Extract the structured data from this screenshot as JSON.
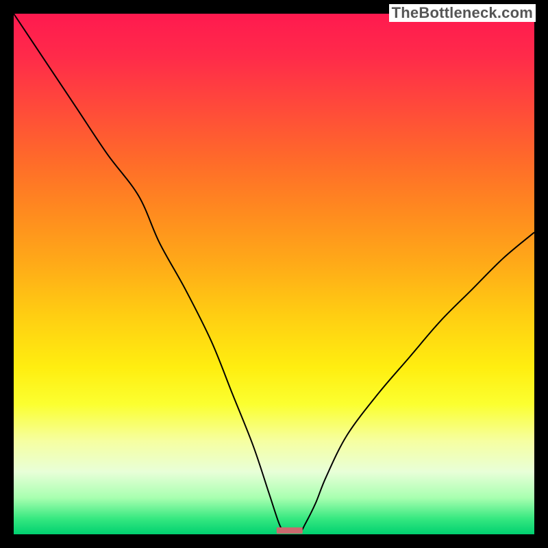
{
  "watermark": "TheBottleneck.com",
  "marker": {
    "x": 53,
    "width": 5,
    "height": 1.2,
    "color": "#c96a6e",
    "radius": 1.5
  },
  "curve": {
    "color": "#000000",
    "width": 2
  },
  "axis": {
    "left_black_bar": true,
    "bottom_black_bar": true
  },
  "chart_data": {
    "type": "line",
    "title": "",
    "xlabel": "",
    "ylabel": "",
    "xlim": [
      0,
      100
    ],
    "ylim": [
      0,
      100
    ],
    "series": [
      {
        "name": "bottleneck-curve",
        "x": [
          0,
          6,
          12,
          18,
          24,
          28,
          33,
          38,
          42,
          46,
          49,
          51,
          52,
          53,
          55,
          56,
          58,
          60,
          64,
          70,
          76,
          82,
          88,
          94,
          100
        ],
        "y": [
          100,
          91,
          82,
          73,
          65,
          56,
          47,
          37,
          27,
          17,
          8,
          2,
          0.5,
          0.5,
          0.5,
          2,
          6,
          11,
          19,
          27,
          34,
          41,
          47,
          53,
          58
        ]
      }
    ],
    "marker": {
      "x": 53,
      "y": 0.3,
      "label": ""
    }
  }
}
